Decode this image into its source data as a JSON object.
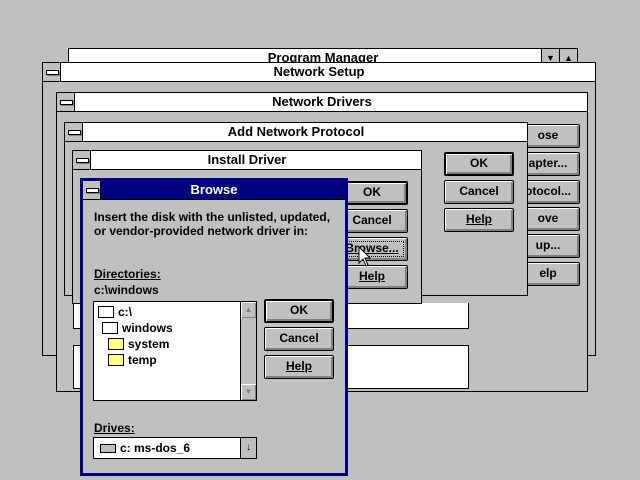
{
  "program_manager": {
    "title": "Program Manager"
  },
  "network_setup": {
    "title": "Network Setup"
  },
  "network_drivers": {
    "title": "Network Drivers"
  },
  "add_network_protocol": {
    "title": "Add Network Protocol",
    "buttons": {
      "ok": "OK",
      "cancel": "Cancel",
      "help": "Help"
    }
  },
  "right_column": {
    "close_partial": "ose",
    "adapter_partial": "apter...",
    "protocol_partial": "otocol...",
    "remove_partial": "ove",
    "setup_partial": "up...",
    "help_partial": "elp"
  },
  "install_driver": {
    "title": "Install Driver",
    "buttons": {
      "ok": "OK",
      "cancel": "Cancel",
      "browse": "Browse...",
      "help": "Help"
    }
  },
  "browse": {
    "title": "Browse",
    "instruction_line1": "Insert the disk with the unlisted, updated,",
    "instruction_line2": "or vendor-provided network driver in:",
    "directories_label": "Directories:",
    "current_path": "c:\\windows",
    "directory_tree": [
      "c:\\",
      "windows",
      "system",
      "temp"
    ],
    "drives_label": "Drives:",
    "drive_selected": "c: ms-dos_6",
    "buttons": {
      "ok": "OK",
      "cancel": "Cancel",
      "help": "Help"
    }
  },
  "colors": {
    "active_title": "#000080",
    "face": "#c0c0c0"
  }
}
